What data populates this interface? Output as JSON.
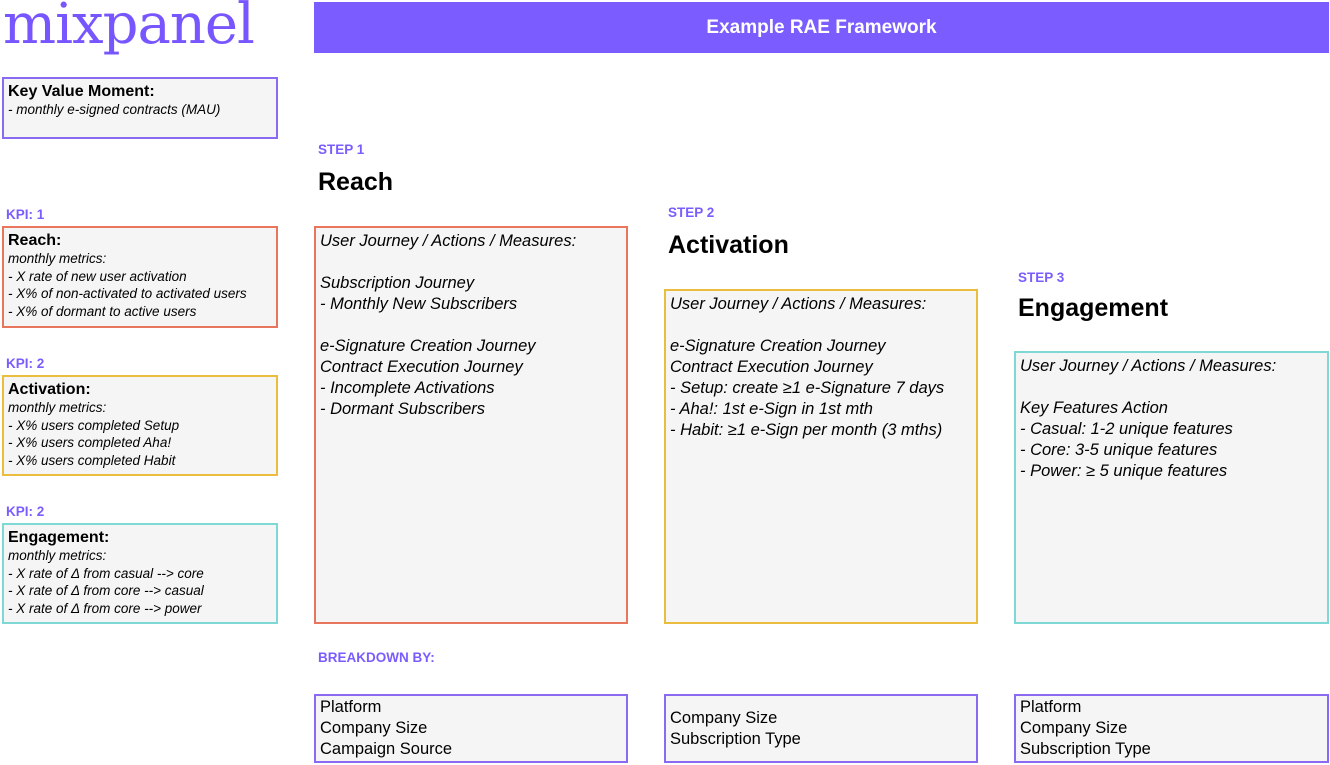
{
  "logo": {
    "text": "mixpanel"
  },
  "title": "Example RAE Framework",
  "key_value_moment": {
    "title": "Key Value Moment:",
    "lines": [
      "- monthly e-signed contracts (MAU)"
    ]
  },
  "kpis": [
    {
      "label": "KPI: 1",
      "title": "Reach:",
      "lines": [
        "monthly metrics:",
        "- X rate of new user activation",
        "- X% of non-activated to activated users",
        "- X% of dormant to active users"
      ]
    },
    {
      "label": "KPI: 2",
      "title": "Activation:",
      "lines": [
        "monthly metrics:",
        "- X% users completed Setup",
        "- X% users completed Aha!",
        "- X% users completed Habit"
      ]
    },
    {
      "label": "KPI: 2",
      "title": "Engagement:",
      "lines": [
        "monthly metrics:",
        "- X rate of Δ from casual --> core",
        "- X rate of Δ from core --> casual",
        "- X rate of Δ from core --> power"
      ]
    }
  ],
  "steps": [
    {
      "label": "STEP 1",
      "heading": "Reach",
      "lines": [
        "User Journey / Actions / Measures:",
        "",
        "Subscription Journey",
        "- Monthly New Subscribers",
        "",
        "e-Signature Creation Journey",
        "Contract Execution Journey",
        "- Incomplete Activations",
        "- Dormant Subscribers"
      ],
      "breakdown": [
        "Platform",
        "Company Size",
        "Campaign Source"
      ]
    },
    {
      "label": "STEP 2",
      "heading": "Activation",
      "lines": [
        "User Journey / Actions / Measures:",
        "",
        "e-Signature Creation Journey",
        "Contract Execution Journey",
        "- Setup: create ≥1 e-Signature 7 days",
        "- Aha!: 1st e-Sign in 1st mth",
        "- Habit: ≥1 e-Sign per month (3 mths)"
      ],
      "breakdown": [
        "Company Size",
        "Subscription Type"
      ]
    },
    {
      "label": "STEP 3",
      "heading": "Engagement",
      "lines": [
        "User Journey / Actions / Measures:",
        "",
        "Key Features Action",
        "- Casual: 1-2 unique features",
        "- Core: 3-5 unique features",
        "- Power: ≥ 5 unique features"
      ],
      "breakdown": [
        "Platform",
        "Company Size",
        "Subscription Type"
      ]
    }
  ],
  "breakdown_label": "BREAKDOWN BY:",
  "colors": {
    "brand_purple": "#7b5cff",
    "reach": "#e8765c",
    "activation": "#ebbd3f",
    "engagement": "#7ed8d4",
    "box_fill": "#f5f5f5"
  }
}
